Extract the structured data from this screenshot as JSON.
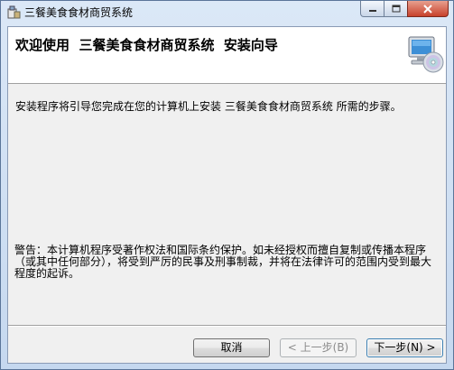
{
  "window": {
    "title": "三餐美食食材商贸系统"
  },
  "banner": {
    "heading": "欢迎使用  三餐美食食材商贸系统  安装向导"
  },
  "content": {
    "intro": "安装程序将引导您完成在您的计算机上安装 三餐美食食材商贸系统 所需的步骤。",
    "warning": "警告：本计算机程序受著作权法和国际条约保护。如未经授权而擅自复制或传播本程序（或其中任何部分），将受到严厉的民事及刑事制裁，并将在法律许可的范围内受到最大程度的起诉。"
  },
  "buttons": {
    "cancel": "取消",
    "back": "< 上一步(B)",
    "next": "下一步(N) >"
  },
  "icons": {
    "app": "installer-icon",
    "banner": "computer-disc-icon"
  }
}
